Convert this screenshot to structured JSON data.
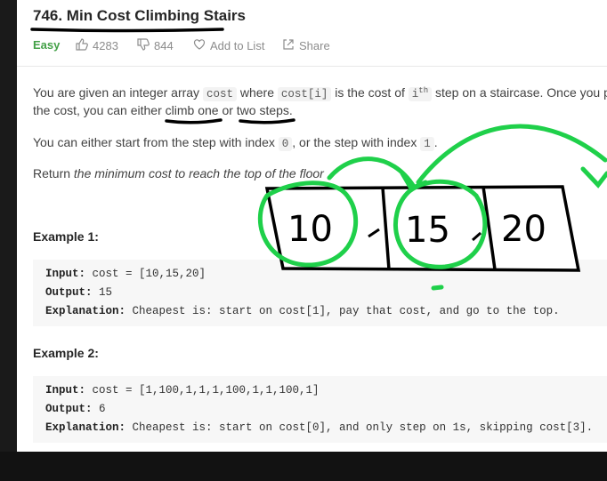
{
  "problem": {
    "title": "746. Min Cost Climbing Stairs",
    "difficulty": "Easy",
    "likes": "4283",
    "dislikes": "844",
    "add_to_list": "Add to List",
    "share": "Share"
  },
  "description": {
    "p1_a": "You are given an integer array ",
    "p1_code1": "cost",
    "p1_b": " where ",
    "p1_code2": "cost[i]",
    "p1_c": " is the cost of ",
    "p1_sup_base": "i",
    "p1_sup": "th",
    "p1_d": " step on a staircase. Once you p",
    "p2": "the cost, you can either climb one or two steps.",
    "p3_a": "You can either start from the step with index ",
    "p3_code1": "0",
    "p3_b": ", or the step with index ",
    "p3_code2": "1",
    "p3_c": ".",
    "p4_a": "Return ",
    "p4_em": "the minimum cost to reach the top of the floor"
  },
  "examples": [
    {
      "heading": "Example 1:",
      "input_label": "Input:",
      "input": " cost = [10,15,20]",
      "output_label": "Output:",
      "output": " 15",
      "explanation_label": "Explanation:",
      "explanation": " Cheapest is: start on cost[1], pay that cost, and go to the top."
    },
    {
      "heading": "Example 2:",
      "input_label": "Input:",
      "input": " cost = [1,100,1,1,1,100,1,1,100,1]",
      "output_label": "Output:",
      "output": " 6",
      "explanation_label": "Explanation:",
      "explanation": " Cheapest is: start on cost[0], and only step on 1s, skipping cost[3]."
    }
  ],
  "annotation": {
    "cells": [
      "10",
      "15",
      "20"
    ],
    "ink_color": "#1fd04a",
    "box_color": "#000000"
  },
  "icons": [
    "thumbs-up-icon",
    "thumbs-down-icon",
    "heart-icon",
    "share-icon"
  ]
}
